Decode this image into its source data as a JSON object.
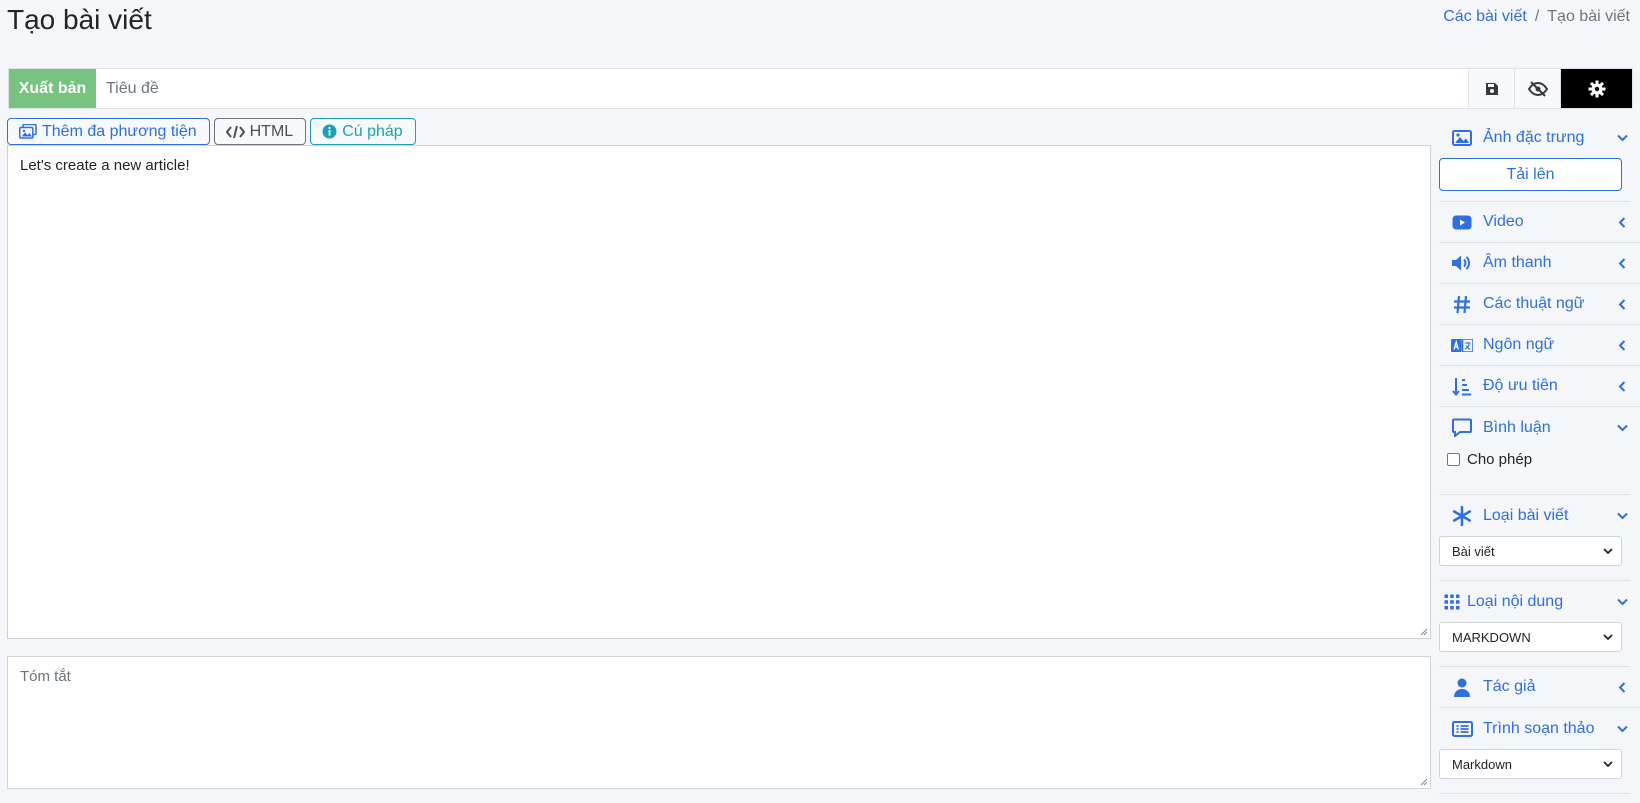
{
  "page": {
    "title": "Tạo bài viết",
    "breadcrumb": {
      "link": "Các bài viết",
      "separator": "/",
      "current": "Tạo bài viết"
    }
  },
  "topbar": {
    "publish_label": "Xuất bản",
    "title_placeholder": "Tiêu đề",
    "icons": [
      "save-icon",
      "eye-slash-icon",
      "gear-icon"
    ]
  },
  "editor": {
    "tools": {
      "media": "Thêm đa phương tiện",
      "html": "HTML",
      "syntax": "Cú pháp"
    },
    "content": "Let's create a new article!",
    "summary_placeholder": "Tóm tắt"
  },
  "sidebar": {
    "featured_image": {
      "label": "Ảnh đặc trưng",
      "upload": "Tải lên"
    },
    "video": "Video",
    "audio": "Âm thanh",
    "terms": "Các thuật ngữ",
    "language": "Ngôn ngữ",
    "priority": "Độ ưu tiên",
    "comments": {
      "label": "Bình luận",
      "allow": "Cho phép"
    },
    "post_type": {
      "label": "Loại bài viết",
      "value": "Bài viết"
    },
    "content_type": {
      "label": "Loại nội dung",
      "value": "MARKDOWN"
    },
    "author": "Tác giả",
    "editor": {
      "label": "Trình soạn thảo",
      "value": "Markdown"
    }
  },
  "colors": {
    "accent": "#2f6fe4",
    "publish": "#79c380",
    "background": "#f4f6f9"
  }
}
